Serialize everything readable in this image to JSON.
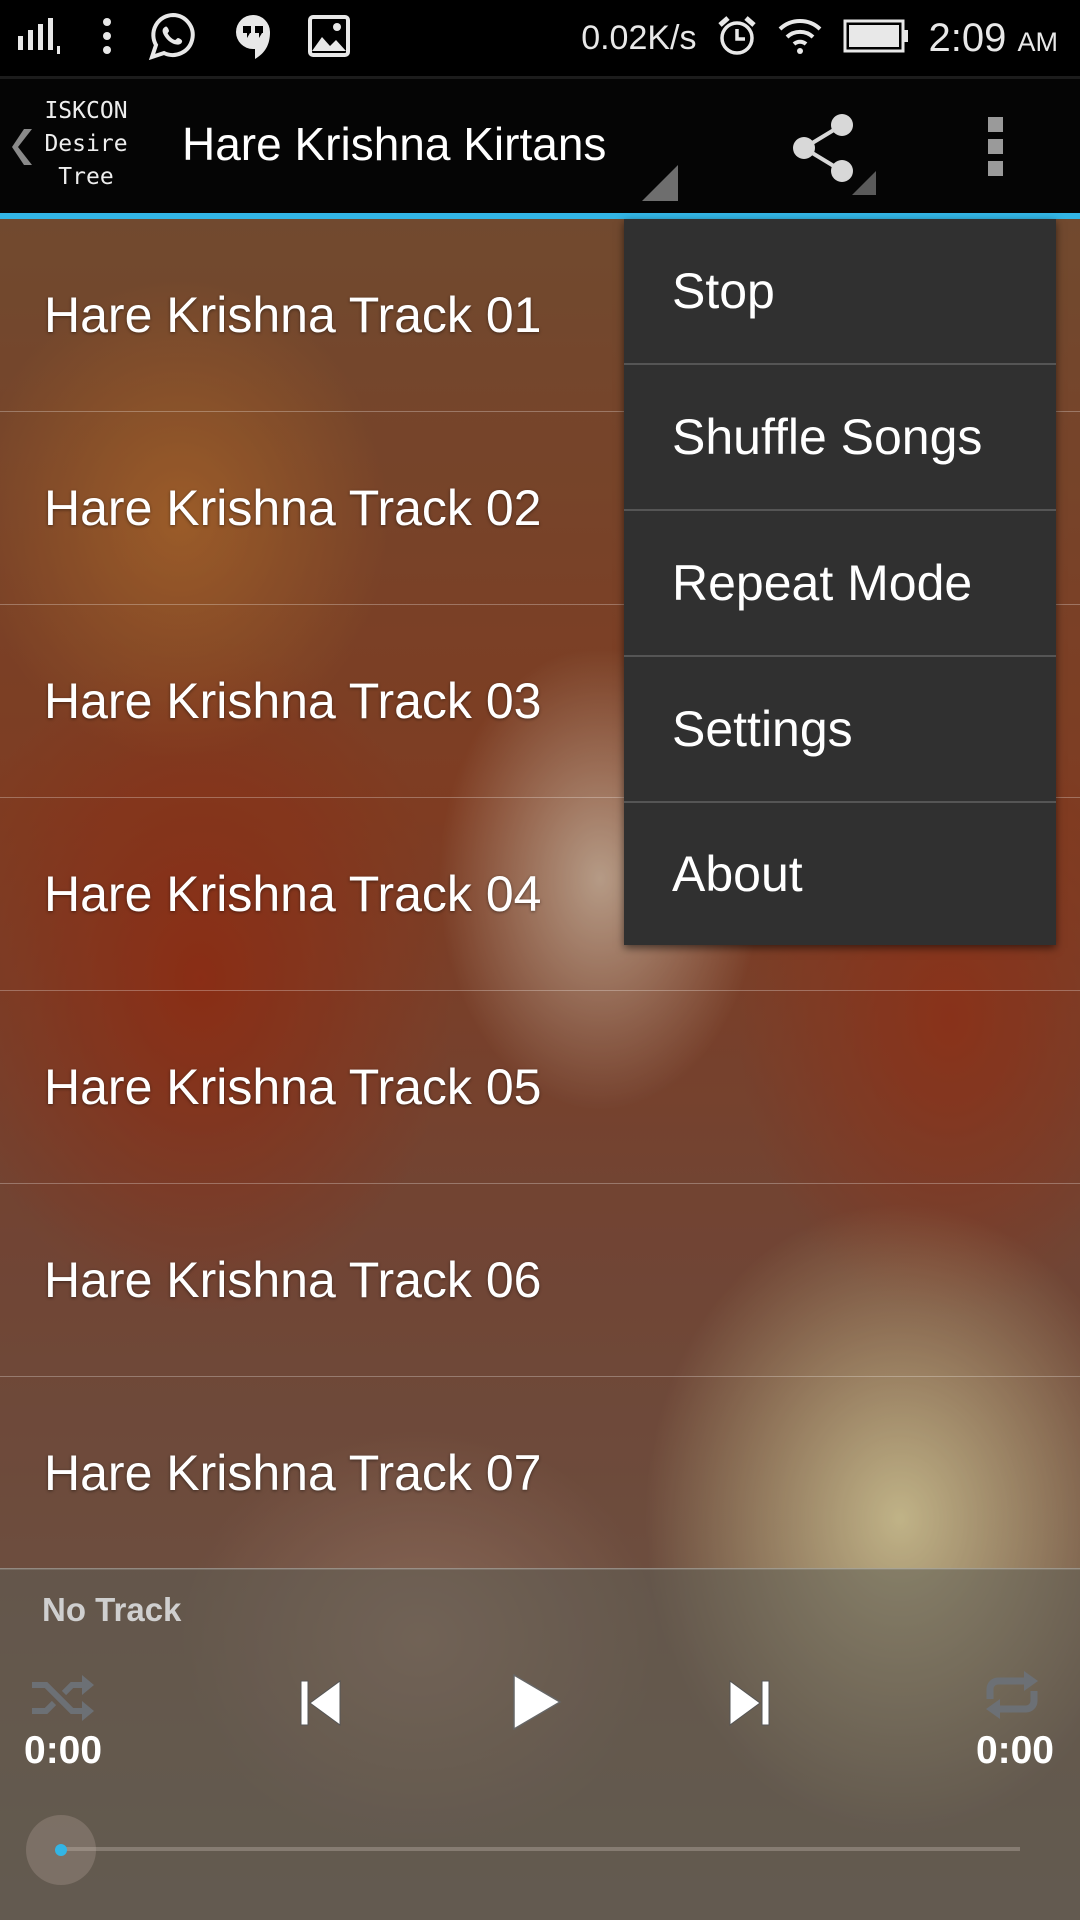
{
  "status_bar": {
    "network_speed": "0.02K/s",
    "time": "2:09",
    "ampm": "AM",
    "icons": [
      "signal-icon",
      "more-notifications-icon",
      "whatsapp-icon",
      "hangouts-icon",
      "gallery-icon",
      "alarm-icon",
      "wifi-icon",
      "battery-icon"
    ]
  },
  "action_bar": {
    "logo_lines": [
      "ISKCON",
      "Desire",
      "Tree"
    ],
    "title": "Hare Krishna Kirtans",
    "accent_color": "#33b5e5"
  },
  "tracks": [
    {
      "label": "Hare Krishna Track 01"
    },
    {
      "label": "Hare Krishna Track 02"
    },
    {
      "label": "Hare Krishna Track 03"
    },
    {
      "label": "Hare Krishna Track 04"
    },
    {
      "label": "Hare Krishna Track 05"
    },
    {
      "label": "Hare Krishna Track 06"
    },
    {
      "label": "Hare Krishna Track 07"
    }
  ],
  "overflow_menu": {
    "items": [
      {
        "label": "Stop"
      },
      {
        "label": "Shuffle Songs"
      },
      {
        "label": "Repeat Mode"
      },
      {
        "label": "Settings"
      },
      {
        "label": "About"
      }
    ]
  },
  "player": {
    "now_playing": "No Track",
    "current_time": "0:00",
    "total_time": "0:00",
    "progress": 0,
    "controls": [
      "shuffle-icon",
      "previous-icon",
      "play-icon",
      "next-icon",
      "repeat-icon"
    ]
  }
}
